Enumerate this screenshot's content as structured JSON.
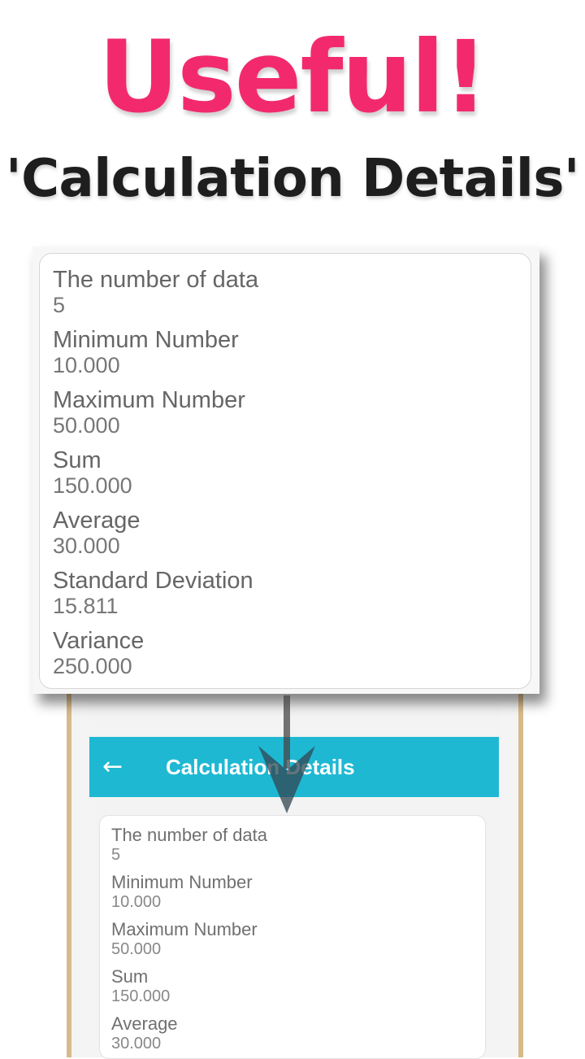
{
  "headline": {
    "title": "Useful!",
    "subtitle": "'Calculation Details'"
  },
  "colors": {
    "headline": "#f22a6d",
    "toolbar": "#1eb8d3"
  },
  "details_card": {
    "items": [
      {
        "label": "The number of data",
        "value": "5"
      },
      {
        "label": "Minimum Number",
        "value": "10.000"
      },
      {
        "label": "Maximum Number",
        "value": "50.000"
      },
      {
        "label": "Sum",
        "value": "150.000"
      },
      {
        "label": "Average",
        "value": "30.000"
      },
      {
        "label": "Standard Deviation",
        "value": "15.811"
      },
      {
        "label": "Variance",
        "value": "250.000"
      }
    ]
  },
  "phone_screen": {
    "toolbar": {
      "back_icon": "arrow-left-icon",
      "back_glyph": "←",
      "title": "Calculation Details"
    },
    "items": [
      {
        "label": "The number of data",
        "value": "5"
      },
      {
        "label": "Minimum Number",
        "value": "10.000"
      },
      {
        "label": "Maximum Number",
        "value": "50.000"
      },
      {
        "label": "Sum",
        "value": "150.000"
      },
      {
        "label": "Average",
        "value": "30.000"
      }
    ]
  }
}
